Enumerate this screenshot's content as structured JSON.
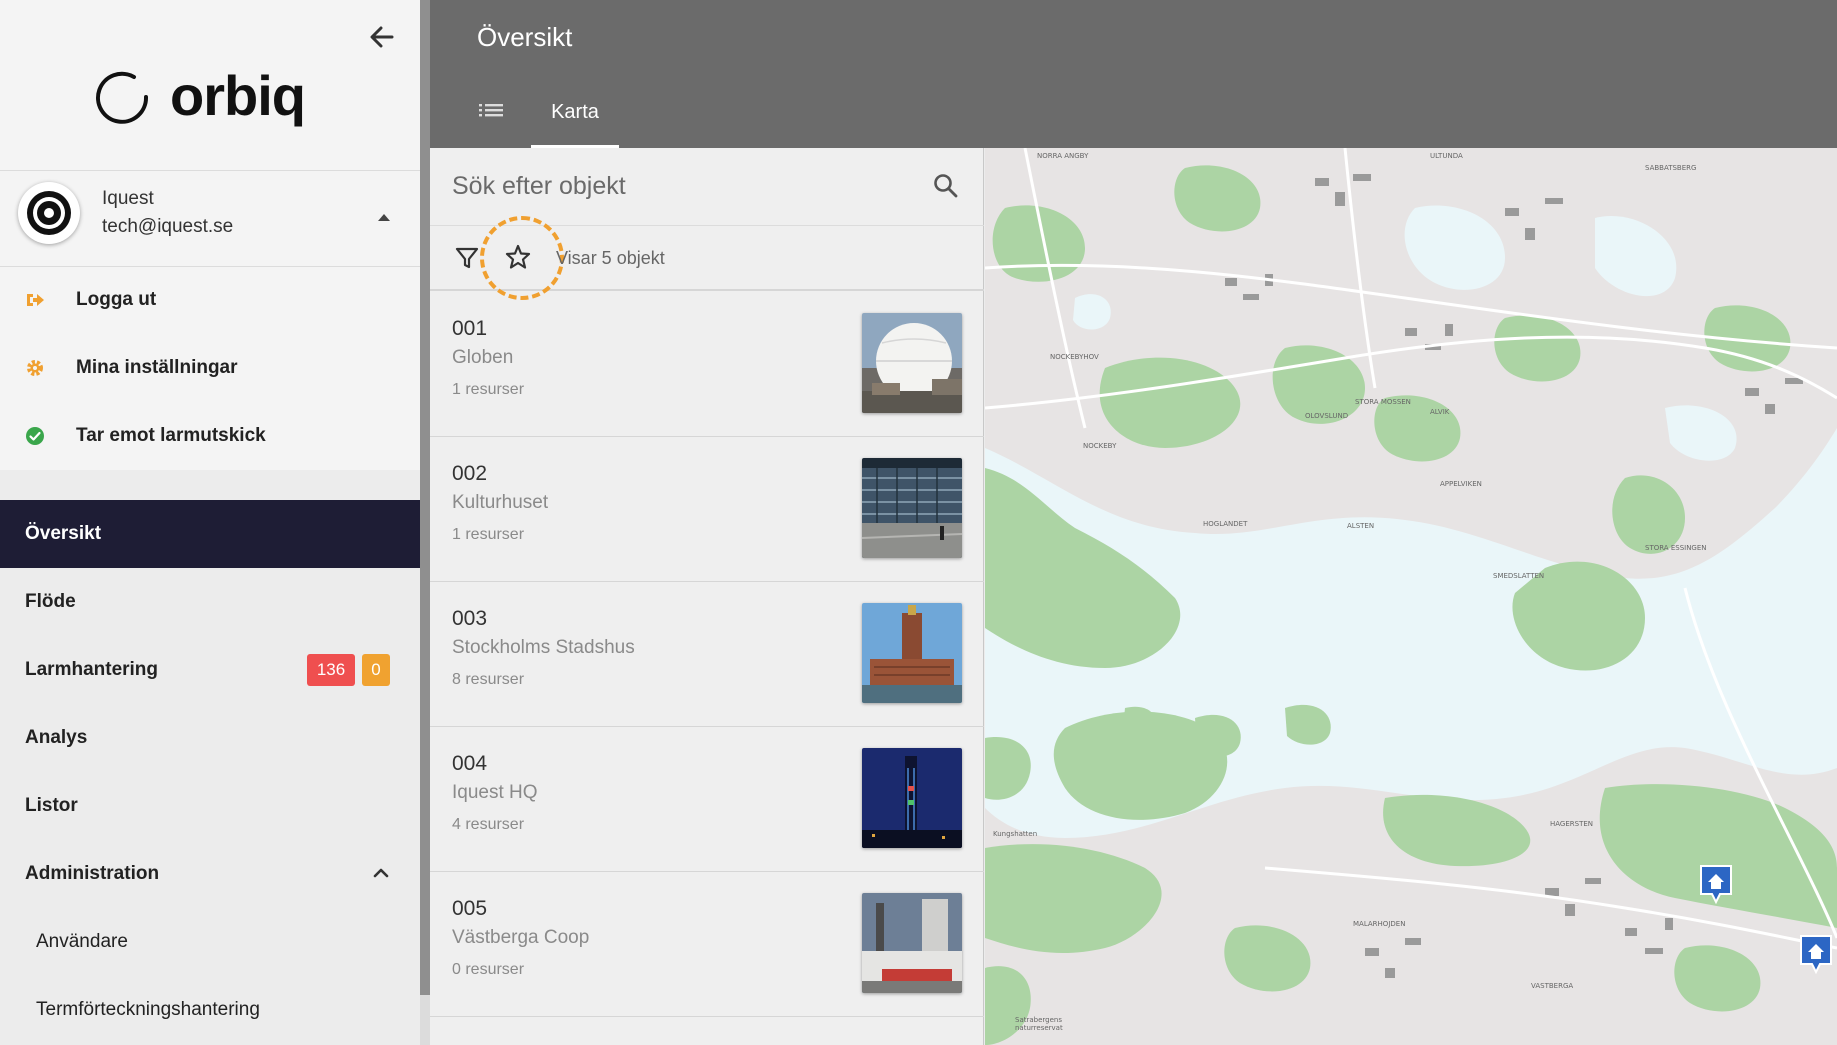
{
  "app": {
    "brand": "orbiq"
  },
  "user": {
    "name": "Iquest",
    "email": "tech@iquest.se"
  },
  "account_menu": [
    {
      "label": "Logga ut",
      "icon": "logout-icon"
    },
    {
      "label": "Mina inställningar",
      "icon": "gear-icon"
    },
    {
      "label": "Tar emot larmutskick",
      "icon": "check-circle-icon"
    }
  ],
  "nav": {
    "items": [
      {
        "label": "Översikt",
        "active": true
      },
      {
        "label": "Flöde"
      },
      {
        "label": "Larmhantering",
        "badges": [
          "136",
          "0"
        ]
      },
      {
        "label": "Analys"
      },
      {
        "label": "Listor"
      },
      {
        "label": "Administration",
        "expanded": true
      }
    ],
    "sub_items": [
      {
        "label": "Användare"
      },
      {
        "label": "Termförteckningshantering"
      }
    ]
  },
  "header": {
    "title": "Översikt",
    "tabs": [
      {
        "icon": "list-icon"
      },
      {
        "label": "Karta",
        "active": true
      }
    ]
  },
  "search": {
    "placeholder": "Sök efter objekt",
    "value": ""
  },
  "filter": {
    "count_text": "Visar 5 objekt"
  },
  "objects": [
    {
      "number": "001",
      "name": "Globen",
      "resources": "1 resurser"
    },
    {
      "number": "002",
      "name": "Kulturhuset",
      "resources": "1 resurser"
    },
    {
      "number": "003",
      "name": "Stockholms Stadshus",
      "resources": "8 resurser"
    },
    {
      "number": "004",
      "name": "Iquest HQ",
      "resources": "4 resurser"
    },
    {
      "number": "005",
      "name": "Västberga Coop",
      "resources": "0 resurser"
    }
  ],
  "map": {
    "labels": [
      "NORRA ANGBY",
      "ULTUNDA",
      "SABBATSBERG",
      "NOCKEBYHOV",
      "ALVIK",
      "OLOVSLUND",
      "STORA MOSSEN",
      "NOCKEBY",
      "APPELVIKEN",
      "HOGLANDET",
      "ALSTEN",
      "SMEDSLATTEN",
      "STORA ESSINGEN",
      "Kungshatten",
      "MALARHOJDEN",
      "HAGERSTEN",
      "VASTBERGA",
      "Satrabergens naturreservat"
    ]
  },
  "colors": {
    "nav_active_bg": "#1e1d35",
    "header_bg": "#6b6b6b",
    "badge_red": "#ef4f4f",
    "badge_orange": "#f0a230",
    "highlight": "#f0a030",
    "map_water": "#eaf6f9",
    "map_green": "#acd4a4",
    "map_land": "#e7e4e4"
  }
}
